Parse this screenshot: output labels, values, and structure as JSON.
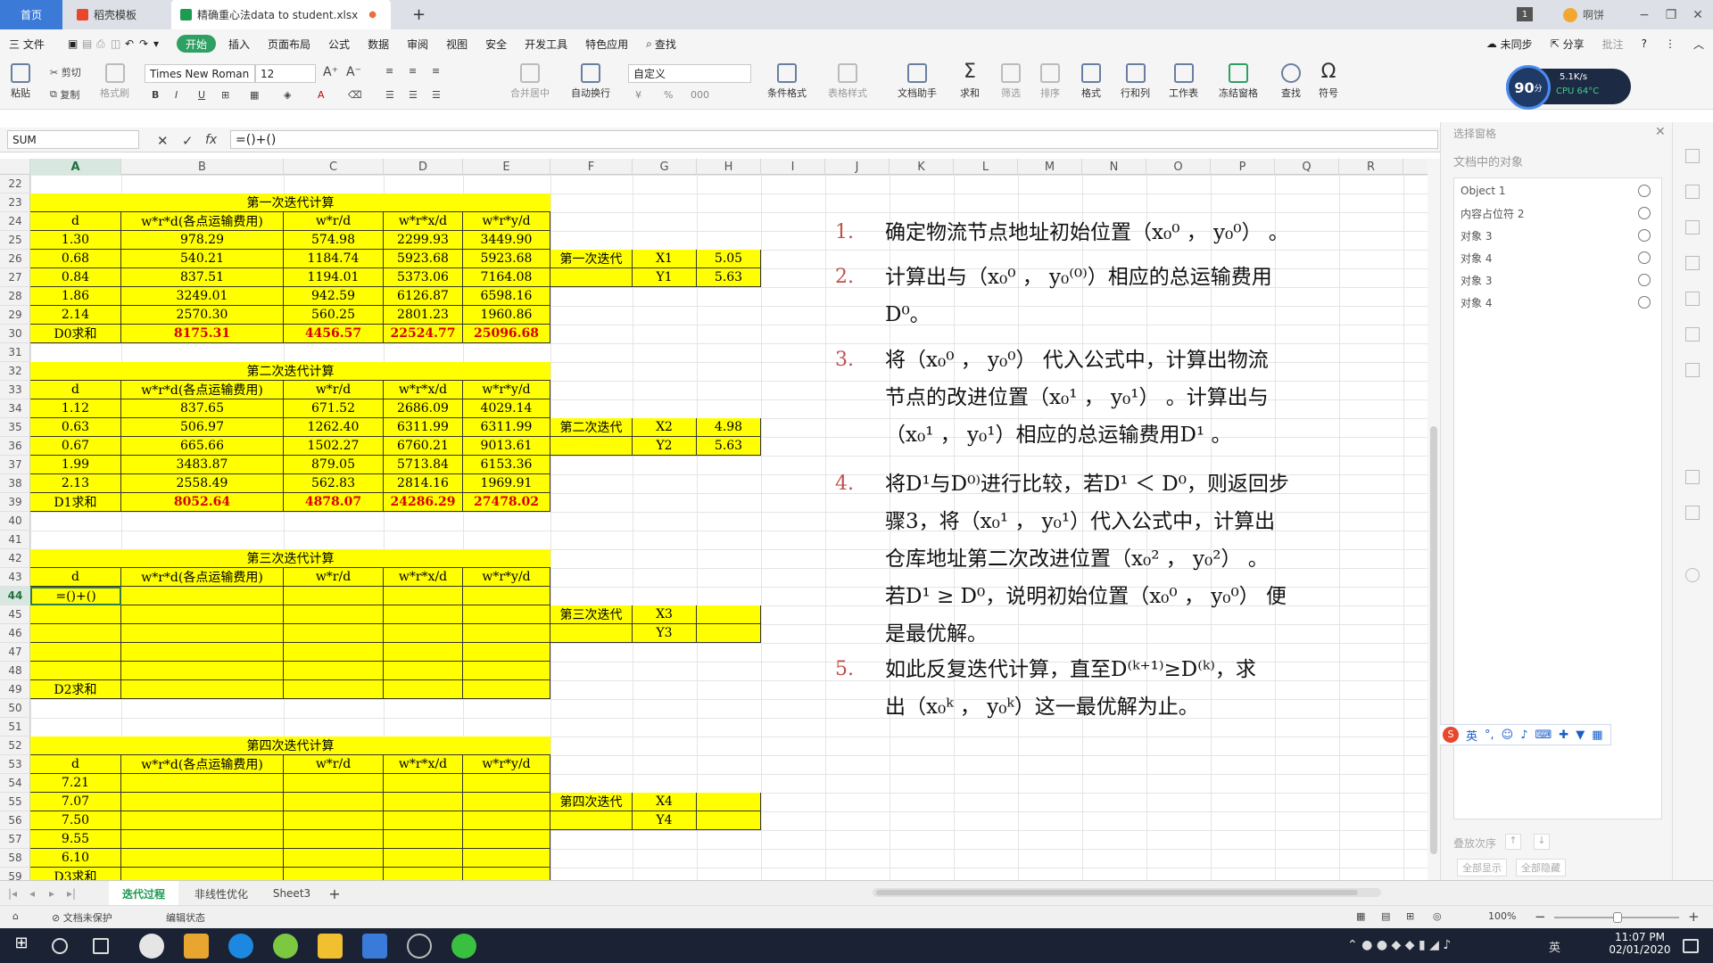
{
  "titlebar": {
    "home_tab": "首页",
    "tab2": "稻壳模板",
    "file_tab": "精确重心法data to student.xlsx",
    "add": "+"
  },
  "menu": {
    "file": "三 文件",
    "items": [
      "开始",
      "插入",
      "页面布局",
      "公式",
      "数据",
      "审阅",
      "视图",
      "安全",
      "开发工具",
      "特色应用",
      "查找"
    ],
    "sync": "未同步",
    "share": "分享",
    "comment": "批注"
  },
  "ribbon": {
    "cut": "剪切",
    "copy": "复制",
    "paste": "粘贴",
    "format_painter": "格式刷",
    "font_name": "Times New Roman",
    "font_size": "12",
    "number_format": "自定义",
    "merge": "合并居中",
    "wrap": "自动换行",
    "cond": "条件格式",
    "table_style": "表格样式",
    "doc_helper": "文档助手",
    "sum": "求和",
    "filter": "筛选",
    "sort": "排序",
    "format": "格式",
    "rowcol": "行和列",
    "sheet": "工作表",
    "freeze": "冻结窗格",
    "find": "查找",
    "symbol": "符号",
    "perf_score": "90",
    "perf_unit": "分",
    "net": "5.1K/s",
    "cpu": "CPU 64°C"
  },
  "formula": {
    "name_box": "SUM",
    "fx": "fx",
    "content": "=()+()"
  },
  "columns": [
    "A",
    "B",
    "C",
    "D",
    "E",
    "F",
    "G",
    "H",
    "I",
    "J",
    "K",
    "L",
    "M",
    "N",
    "O",
    "P",
    "Q",
    "R"
  ],
  "rows": [
    "22",
    "23",
    "24",
    "25",
    "26",
    "27",
    "28",
    "29",
    "30",
    "31",
    "32",
    "33",
    "34",
    "35",
    "36",
    "37",
    "38",
    "39",
    "40",
    "41",
    "42",
    "43",
    "44",
    "45",
    "46",
    "47",
    "48",
    "49",
    "50",
    "51",
    "52",
    "53",
    "54",
    "55",
    "56",
    "57",
    "58",
    "59"
  ],
  "iter1": {
    "title": "第一次迭代计算",
    "headers": [
      "d",
      "w*r*d(各点运输费用)",
      "w*r/d",
      "w*r*x/d",
      "w*r*y/d"
    ],
    "rows": [
      [
        "1.30",
        "978.29",
        "574.98",
        "2299.93",
        "3449.90"
      ],
      [
        "0.68",
        "540.21",
        "1184.74",
        "5923.68",
        "5923.68"
      ],
      [
        "0.84",
        "837.51",
        "1194.01",
        "5373.06",
        "7164.08"
      ],
      [
        "1.86",
        "3249.01",
        "942.59",
        "6126.87",
        "6598.16"
      ],
      [
        "2.14",
        "2570.30",
        "560.25",
        "2801.23",
        "1960.86"
      ]
    ],
    "sum": [
      "D0求和",
      "8175.31",
      "4456.57",
      "22524.77",
      "25096.68"
    ],
    "label": "第一次迭代",
    "x": "X1",
    "xv": "5.05",
    "y": "Y1",
    "yv": "5.63"
  },
  "iter2": {
    "title": "第二次迭代计算",
    "headers": [
      "d",
      "w*r*d(各点运输费用)",
      "w*r/d",
      "w*r*x/d",
      "w*r*y/d"
    ],
    "rows": [
      [
        "1.12",
        "837.65",
        "671.52",
        "2686.09",
        "4029.14"
      ],
      [
        "0.63",
        "506.97",
        "1262.40",
        "6311.99",
        "6311.99"
      ],
      [
        "0.67",
        "665.66",
        "1502.27",
        "6760.21",
        "9013.61"
      ],
      [
        "1.99",
        "3483.87",
        "879.05",
        "5713.84",
        "6153.36"
      ],
      [
        "2.13",
        "2558.49",
        "562.83",
        "2814.16",
        "1969.91"
      ]
    ],
    "sum": [
      "D1求和",
      "8052.64",
      "4878.07",
      "24286.29",
      "27478.02"
    ],
    "label": "第二次迭代",
    "x": "X2",
    "xv": "4.98",
    "y": "Y2",
    "yv": "5.63"
  },
  "iter3": {
    "title": "第三次迭代计算",
    "headers": [
      "d",
      "w*r*d(各点运输费用)",
      "w*r/d",
      "w*r*x/d",
      "w*r*y/d"
    ],
    "active": "=()+()",
    "sum": "D2求和",
    "label": "第三次迭代",
    "x": "X3",
    "y": "Y3"
  },
  "iter4": {
    "title": "第四次迭代计算",
    "headers": [
      "d",
      "w*r*d(各点运输费用)",
      "w*r/d",
      "w*r*x/d",
      "w*r*y/d"
    ],
    "d": [
      "7.21",
      "7.07",
      "7.50",
      "9.55",
      "6.10"
    ],
    "sum": "D3求和",
    "label": "第四次迭代",
    "x": "X4",
    "y": "Y4"
  },
  "steps": [
    {
      "n": "1.",
      "lines": [
        "确定物流节点地址初始位置（x₀⁰ ， y₀⁰） 。"
      ]
    },
    {
      "n": "2.",
      "lines": [
        "计算出与（x₀⁰ ， y₀⁽⁰⁾）相应的总运输费用",
        "D⁰。"
      ]
    },
    {
      "n": "3.",
      "lines": [
        "将（x₀⁰ ， y₀⁰） 代入公式中，计算出物流",
        "节点的改进位置（x₀¹ ， y₀¹） 。计算出与",
        "（x₀¹ ， y₀¹）相应的总运输费用D¹ 。"
      ]
    },
    {
      "n": "4.",
      "lines": [
        "将D¹与D⁰⁾进行比较，若D¹ ＜ D⁰，则返回步",
        "骤3，将（x₀¹ ， y₀¹）代入公式中，计算出",
        "仓库地址第二次改进位置（x₀² ， y₀²） 。",
        "若D¹ ≥ D⁰，说明初始位置（x₀⁰ ， y₀⁰） 便",
        "是最优解。"
      ]
    },
    {
      "n": "5.",
      "lines": [
        "如此反复迭代计算，直至D⁽ᵏ⁺¹⁾≥D⁽ᵏ⁾，求",
        "出（x₀ᵏ ， y₀ᵏ）这一最优解为止。"
      ]
    }
  ],
  "panel": {
    "title": "选择窗格",
    "subtitle": "文档中的对象",
    "items": [
      "Object 1",
      "内容占位符 2",
      "对象 3",
      "对象 4",
      "对象 3",
      "对象 4"
    ],
    "order": "叠放次序",
    "show_all": "全部显示",
    "hide_all": "全部隐藏"
  },
  "ime": {
    "label": "英"
  },
  "sheets": [
    "迭代过程",
    "非线性优化",
    "Sheet3"
  ],
  "status": {
    "protect": "文档未保护",
    "edit": "编辑状态",
    "zoom": "100%"
  },
  "taskbar": {
    "time": "11:07 PM",
    "date": "02/01/2020",
    "lang": "英"
  }
}
